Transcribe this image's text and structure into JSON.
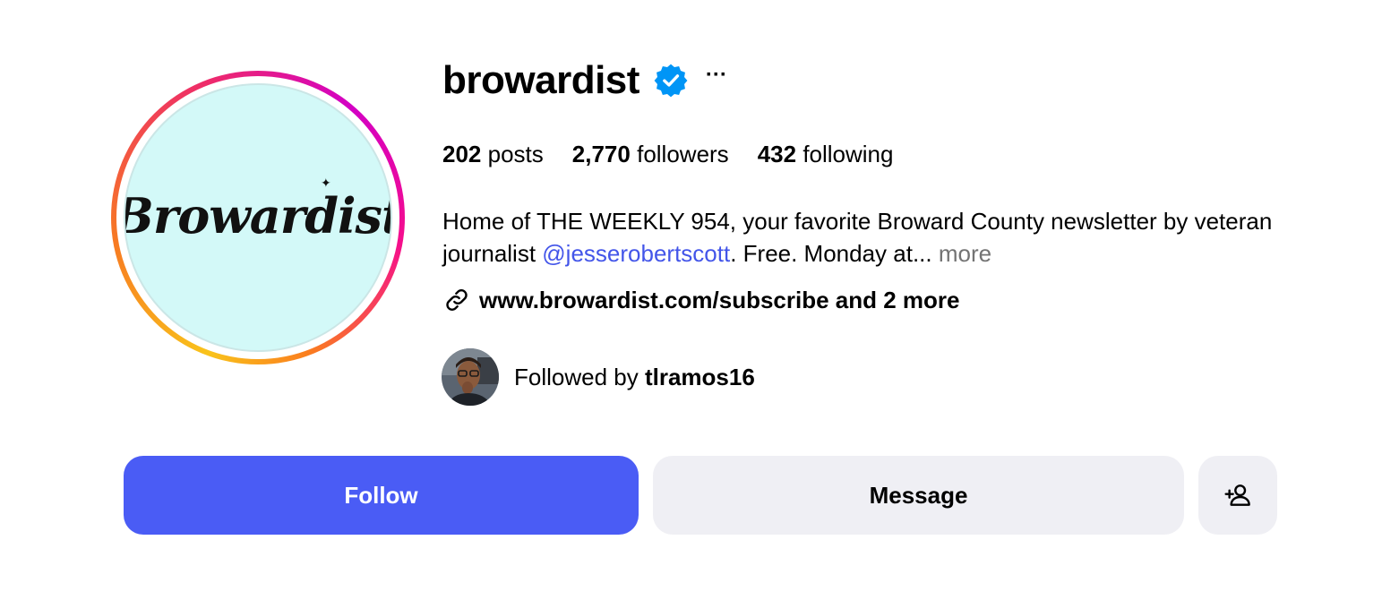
{
  "profile": {
    "username": "browardist",
    "verified": true,
    "more_options_label": "···",
    "avatar_logo_text": "Browardist"
  },
  "stats": {
    "posts_count": "202",
    "posts_label": "posts",
    "followers_count": "2,770",
    "followers_label": "followers",
    "following_count": "432",
    "following_label": "following"
  },
  "bio": {
    "line_before_mention": "Home of THE WEEKLY 954, your favorite Broward County newsletter by veteran journalist ",
    "mention": "@jesserobertscott",
    "line_after_mention": ". Free. Monday at... ",
    "more_label": "more"
  },
  "link": {
    "text": "www.browardist.com/subscribe and 2 more",
    "icon": "link-icon"
  },
  "followed_by": {
    "prefix": "Followed by ",
    "username": "tlramos16"
  },
  "actions": {
    "follow_label": "Follow",
    "message_label": "Message",
    "suggest_icon": "add-person-icon"
  },
  "colors": {
    "follow_button": "#4a5cf5",
    "secondary_button": "#efeff4",
    "mention": "#4355e9",
    "verified_badge": "#0095f6",
    "avatar_bg": "#d3f9f8"
  }
}
